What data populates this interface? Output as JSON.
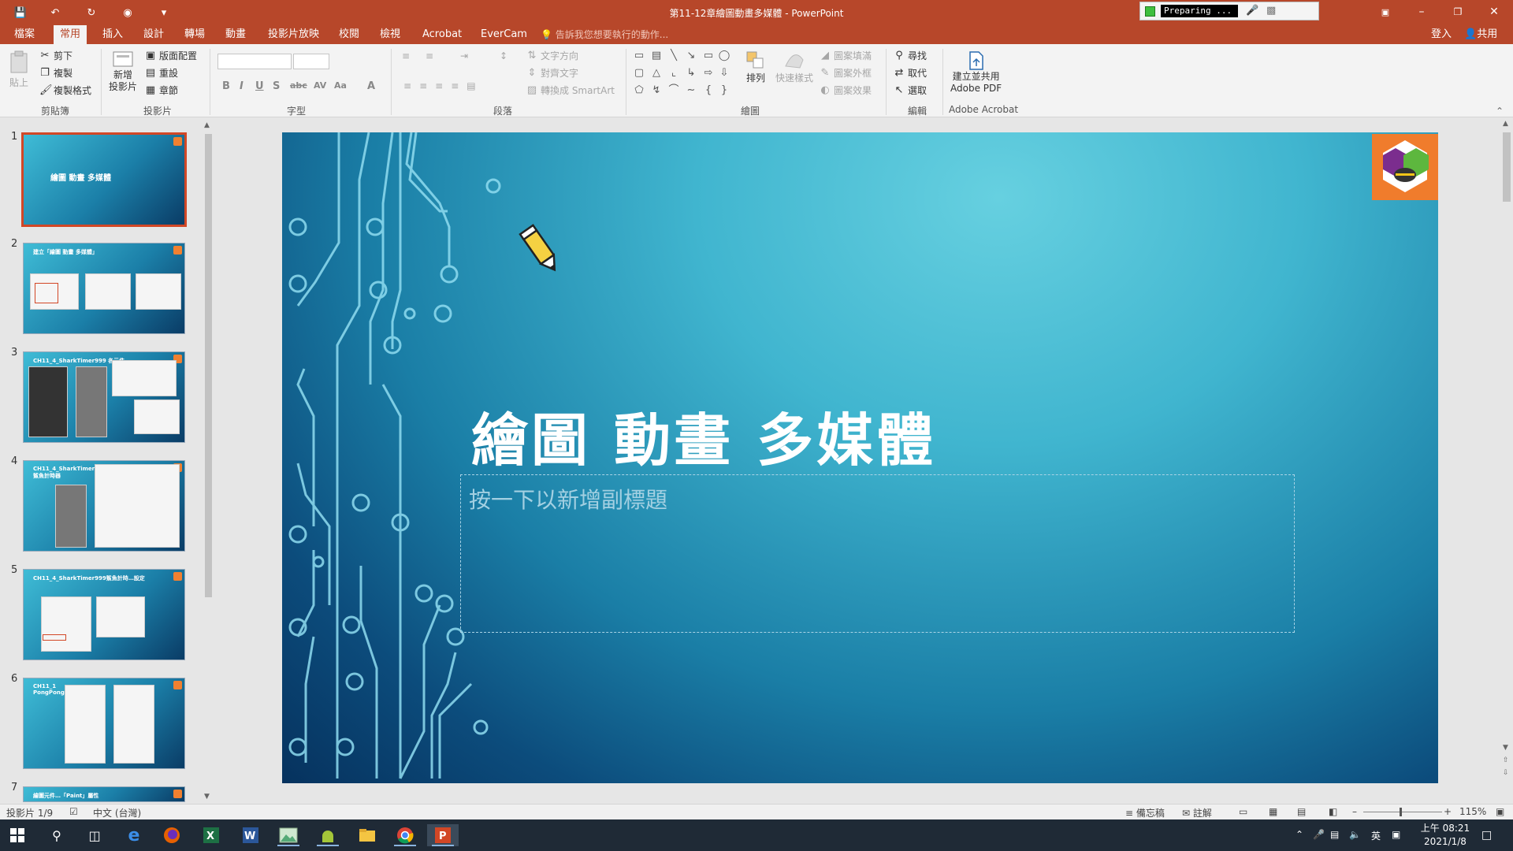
{
  "window": {
    "title": "第11-12章繪圖動畫多媒體 - PowerPoint",
    "recorder_status": "Preparing ..."
  },
  "tabs": [
    {
      "label": "檔案",
      "active": false
    },
    {
      "label": "常用",
      "active": true
    },
    {
      "label": "插入",
      "active": false
    },
    {
      "label": "設計",
      "active": false
    },
    {
      "label": "轉場",
      "active": false
    },
    {
      "label": "動畫",
      "active": false
    },
    {
      "label": "投影片放映",
      "active": false
    },
    {
      "label": "校閱",
      "active": false
    },
    {
      "label": "檢視",
      "active": false
    },
    {
      "label": "Acrobat",
      "active": false
    },
    {
      "label": "EverCam",
      "active": false
    }
  ],
  "tell_me": "告訴我您想要執行的動作...",
  "account": {
    "signin": "登入",
    "share": "共用"
  },
  "ribbon": {
    "clipboard": {
      "paste": "貼上",
      "cut": "剪下",
      "copy": "複製",
      "format_painter": "複製格式",
      "label": "剪貼簿"
    },
    "slides": {
      "new_slide_line1": "新增",
      "new_slide_line2": "投影片",
      "layout": "版面配置",
      "reset": "重設",
      "section": "章節",
      "label": "投影片"
    },
    "font": {
      "label": "字型"
    },
    "paragraph": {
      "text_direction": "文字方向",
      "align_text": "對齊文字",
      "smartart": "轉換成 SmartArt",
      "label": "段落"
    },
    "drawing": {
      "arrange": "排列",
      "quick_styles": "快速樣式",
      "shape_fill": "圖案填滿",
      "shape_outline": "圖案外框",
      "shape_effects": "圖案效果",
      "label": "繪圖"
    },
    "editing": {
      "find": "尋找",
      "replace": "取代",
      "select": "選取",
      "label": "編輯"
    },
    "acrobat": {
      "line1": "建立並共用",
      "line2": "Adobe PDF",
      "label": "Adobe Acrobat"
    }
  },
  "thumbnails": [
    {
      "num": "1",
      "title": "繪圖 動畫 多媒體"
    },
    {
      "num": "2",
      "title": "建立「繪圖 動畫 多媒體」"
    },
    {
      "num": "3",
      "title": "CH11_4_SharkTimer999 各元件"
    },
    {
      "num": "4",
      "title": "CH11_4_SharkTimer999 鯊魚計時器"
    },
    {
      "num": "5",
      "title": "CH11_4_SharkTimer999鯊魚計時…設定"
    },
    {
      "num": "6",
      "title": "CH11_1 PongPong999"
    },
    {
      "num": "7",
      "title": "繪圖元件…「Paint」屬性"
    }
  ],
  "slide": {
    "title": "繪圖 動畫 多媒體",
    "subtitle_placeholder": "按一下以新增副標題"
  },
  "status": {
    "slide_count": "投影片 1/9",
    "language": "中文 (台灣)",
    "notes": "備忘稿",
    "comments": "註解",
    "zoom": "115%"
  },
  "taskbar": {
    "tray_lang": "英",
    "time": "上午 08:21",
    "date": "2021/1/8"
  },
  "colors": {
    "accent": "#b7472a",
    "slide_dark": "#06325e",
    "slide_light": "#66d0e0"
  }
}
